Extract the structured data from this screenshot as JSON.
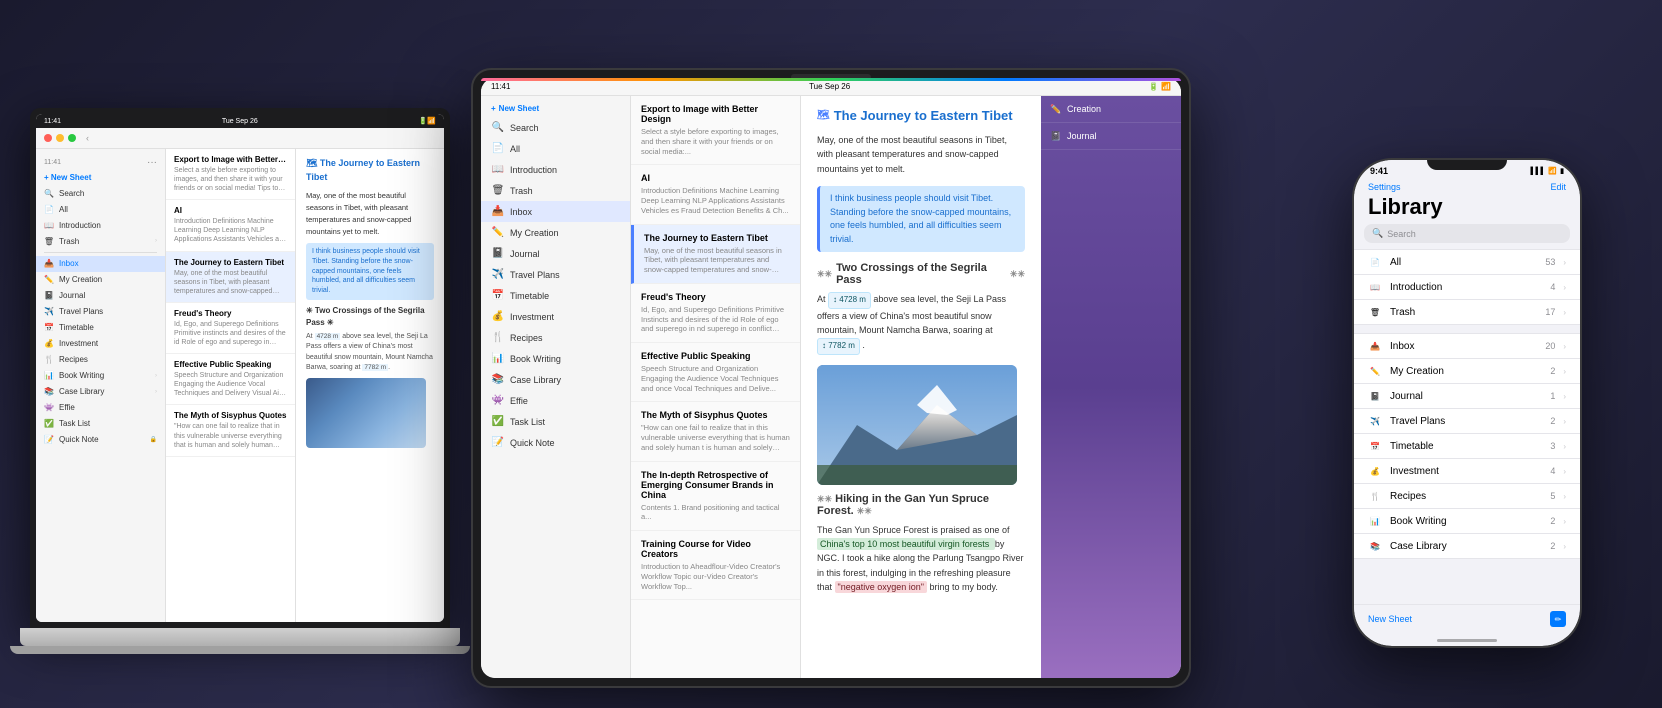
{
  "scene": {
    "background_color": "#2a2a3a"
  },
  "macbook": {
    "status_bar": {
      "time": "11:41",
      "date": "Tue Sep 26",
      "dots": "..."
    },
    "titlebar": {
      "dots": [
        "red",
        "yellow",
        "green"
      ],
      "chevron_label": "‹"
    },
    "new_sheet_label": "+ New Sheet",
    "sidebar_items": [
      {
        "icon": "🔍",
        "label": "Search",
        "active": false
      },
      {
        "icon": "📄",
        "label": "All",
        "active": false
      },
      {
        "icon": "📖",
        "label": "Introduction",
        "active": false
      },
      {
        "icon": "🗑",
        "label": "Trash",
        "active": false
      },
      {
        "icon": "📥",
        "label": "Inbox",
        "active": false
      },
      {
        "icon": "✏️",
        "label": "My Creation",
        "active": false
      },
      {
        "icon": "📓",
        "label": "Journal",
        "active": false
      },
      {
        "icon": "✈️",
        "label": "Travel Plans",
        "active": false
      },
      {
        "icon": "📅",
        "label": "Timetable",
        "active": false
      },
      {
        "icon": "💰",
        "label": "Investment",
        "active": false
      },
      {
        "icon": "🍴",
        "label": "Recipes",
        "active": false
      },
      {
        "icon": "📊",
        "label": "Book Writing",
        "active": false,
        "chevron": true
      },
      {
        "icon": "📚",
        "label": "Case Library",
        "active": false,
        "chevron": true
      },
      {
        "icon": "👾",
        "label": "Effie",
        "active": false
      },
      {
        "icon": "✅",
        "label": "Task List",
        "active": false
      },
      {
        "icon": "📝",
        "label": "Quick Note",
        "active": false,
        "lock": true
      }
    ],
    "notes": [
      {
        "title": "Export to Image with Better Design",
        "preview": "Select a style before exporting to images, and then share it with your friends or on social media! Tips to make the image more aes...",
        "active": false
      },
      {
        "title": "AI",
        "preview": "Introduction Definitions Machine Learning Deep Learning NLP Applications Assistants Vehicles as Fraud Detection Benefits & Challe...",
        "active": false
      },
      {
        "title": "The Journey to Eastern Tibet",
        "preview": "May, one of the most beautiful seasons in Tibet, with pleasant temperatures and snow-capped mountains yet to melt. I think busi...",
        "active": true
      },
      {
        "title": "Freud's Theory",
        "preview": "Id, Ego, and Superego Definitions Primitive instincts and desires of the id Role of ego and superego in conflict resolution Conflict resoluti...",
        "active": false
      },
      {
        "title": "Effective Public Speaking",
        "preview": "Speech Structure and Organization Engaging the Audience Vocal Techniques and Delivery Visual Aids and Props Overcoming Stage Anxi...",
        "active": false
      },
      {
        "title": "The Myth of Sisyphus Quotes",
        "preview": "\"How can one fail to realize that in this vulnerable universe everything that is human and solely human assumes a more vivid meaning?\"...",
        "active": false
      }
    ]
  },
  "ipad": {
    "status_bar": {
      "time": "11:41",
      "date": "Tue Sep 26",
      "icons": "..."
    },
    "sidebar_items": [
      {
        "icon": "+ ",
        "label": "New Sheet",
        "color": "blue"
      },
      {
        "icon": "🔍",
        "label": "Search"
      },
      {
        "icon": "📄",
        "label": "All"
      },
      {
        "icon": "📖",
        "label": "Introduction"
      },
      {
        "icon": "🗑",
        "label": "Trash"
      },
      {
        "icon": "📥",
        "label": "Inbox",
        "active": true
      },
      {
        "icon": "✏️",
        "label": "My Creation"
      },
      {
        "icon": "📓",
        "label": "Journal"
      },
      {
        "icon": "✈️",
        "label": "Travel Plans"
      },
      {
        "icon": "📅",
        "label": "Timetable"
      },
      {
        "icon": "💰",
        "label": "Investment"
      },
      {
        "icon": "🍴",
        "label": "Recipes"
      },
      {
        "icon": "📊",
        "label": "Book Writing"
      },
      {
        "icon": "📚",
        "label": "Case Library"
      },
      {
        "icon": "👾",
        "label": "Effie"
      },
      {
        "icon": "✅",
        "label": "Task List"
      },
      {
        "icon": "📝",
        "label": "Quick Note"
      }
    ],
    "notes": [
      {
        "title": "Export to Image with Better Design",
        "preview": "Select a style before exporting to images, and then share it with your friends or on social media:...",
        "active": false
      },
      {
        "title": "AI",
        "preview": "Introduction Definitions Machine Learning Deep Learning NLP Applications Assistants Vehicles es Fraud Detection  Benefits & Ch...",
        "active": false
      },
      {
        "title": "The Journey to Eastern Tibet",
        "preview": "May, one of the most beautiful seasons in Tibet, with pleasant temperatures and snow-capped temperatures and snow-capped...",
        "active": true
      },
      {
        "title": "Freud's Theory",
        "preview": "Id, Ego, and Superego Definitions Primitive Instincts and desires of the id Role of ego and superego in nd superego in conflict resolution...",
        "active": false
      },
      {
        "title": "Effective Public Speaking",
        "preview": "Speech Structure and Organization Engaging the Audience Vocal Techniques and once Vocal Techniques and Delive...",
        "active": false
      },
      {
        "title": "The Myth of Sisyphus Quotes",
        "preview": "\"How can one fail to realize that in this vulnerable universe everything that is human and solely human t is human and solely human assu...",
        "active": false
      },
      {
        "title": "The In-depth Retrospective of Emerging Consumer Brands in China",
        "preview": "Contents 1. Brand positioning and tactical a...",
        "active": false
      },
      {
        "title": "Training Course for Video Creators",
        "preview": "Introduction to Aheadflour-Video Creator's Workflow Topic our-Video Creator's Workflow Top...",
        "active": false
      }
    ],
    "content": {
      "title": "🗺 The Journey to Eastern Tibet",
      "paragraphs": [
        "May, one of the most beautiful seasons in Tibet, with pleasant temperatures and snow-capped mountains yet to melt.",
        "I think business people should visit Tibet. Standing before the snow-capped mountains, one feels humbled, and all difficulties seem trivial.",
        "Two Crossings of the Segrila Pass",
        "At  4728 m  above sea level, the Seji La Pass offers a view of China's most beautiful snow mountain, Mount Namcha Barwa, soaring at  7782 m  .",
        "Hiking in the Gan Yun Spruce Forest.",
        "The Gan Yun Spruce Forest is praised as one of  China's top 10 most beautiful virgin forests  by NGC. I took a hike along the Parlung Tsangpo River in this forest,  indulging in the refreshing pleasure that  \"negative oxygen ion\"  bring to my body."
      ]
    },
    "right_panel": {
      "header": "",
      "items": [
        {
          "icon": "✏️",
          "label": "Creation",
          "count": ""
        },
        {
          "icon": "📓",
          "label": "Journal",
          "count": ""
        }
      ]
    }
  },
  "iphone": {
    "status_bar": {
      "time": "9:41",
      "icons": "▌▌▌ WiFi ▮"
    },
    "header": {
      "settings_label": "Settings",
      "edit_label": "Edit"
    },
    "title": "Library",
    "search_placeholder": "Search",
    "list_sections": [
      {
        "items": [
          {
            "icon": "📄",
            "icon_color": "#8e8e93",
            "label": "All",
            "count": "53",
            "chevron": ">"
          },
          {
            "icon": "📖",
            "icon_color": "#ff9500",
            "label": "Introduction",
            "count": "4",
            "chevron": ">"
          },
          {
            "icon": "🗑",
            "icon_color": "#8e8e93",
            "label": "Trash",
            "count": "17",
            "chevron": ">"
          }
        ]
      },
      {
        "items": [
          {
            "icon": "📥",
            "icon_color": "#007aff",
            "label": "Inbox",
            "count": "20",
            "chevron": ">"
          },
          {
            "icon": "✏️",
            "icon_color": "#ff3b30",
            "label": "My Creation",
            "count": "2",
            "chevron": ">"
          },
          {
            "icon": "📓",
            "icon_color": "#ff9500",
            "label": "Journal",
            "count": "1",
            "chevron": ">"
          },
          {
            "icon": "✈️",
            "icon_color": "#5ac8fa",
            "label": "Travel Plans",
            "count": "2",
            "chevron": ">"
          },
          {
            "icon": "📅",
            "icon_color": "#34c759",
            "label": "Timetable",
            "count": "3",
            "chevron": ">"
          },
          {
            "icon": "💰",
            "icon_color": "#ff9500",
            "label": "Investment",
            "count": "4",
            "chevron": ">"
          },
          {
            "icon": "🍴",
            "icon_color": "#ff3b30",
            "label": "Recipes",
            "count": "5",
            "chevron": ">"
          },
          {
            "icon": "📊",
            "icon_color": "#5ac8fa",
            "label": "Book Writing",
            "count": "2",
            "chevron": ">"
          },
          {
            "icon": "📚",
            "icon_color": "#007aff",
            "label": "Case Library",
            "count": "2",
            "chevron": ">"
          }
        ]
      }
    ],
    "new_sheet_label": "New Sheet",
    "home_indicator": true
  }
}
